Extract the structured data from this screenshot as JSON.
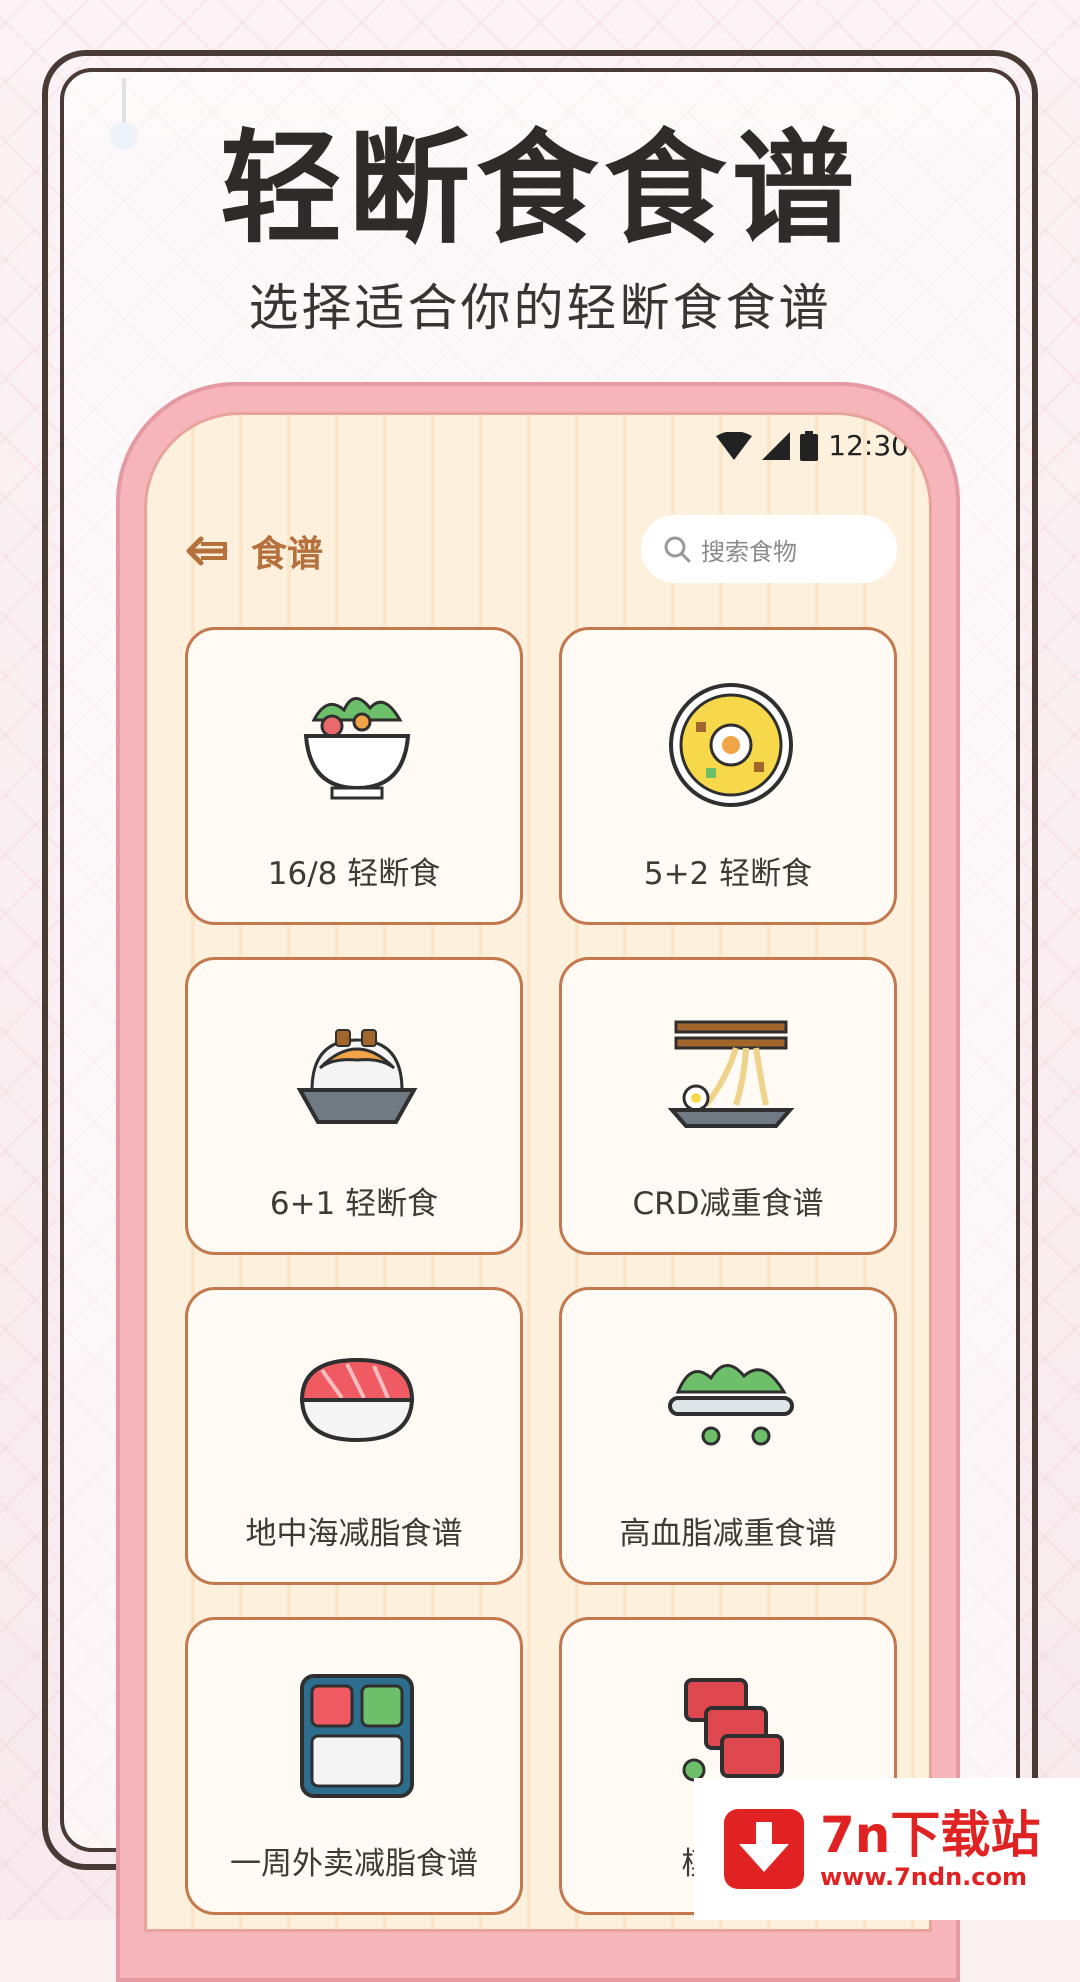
{
  "promo": {
    "headline": "轻断食食谱",
    "subtitle": "选择适合你的轻断食食谱"
  },
  "status_bar": {
    "time": "12:30",
    "icons": [
      "wifi-icon",
      "cellular-signal-icon",
      "battery-icon"
    ]
  },
  "app_bar": {
    "back_icon": "back-arrow-icon",
    "title": "食谱",
    "search_placeholder": "搜索食物"
  },
  "recipes": [
    {
      "label": "16/8 轻断食",
      "icon": "salad-bowl-icon"
    },
    {
      "label": "5+2 轻断食",
      "icon": "fried-egg-rice-plate-icon"
    },
    {
      "label": "6+1 轻断食",
      "icon": "rice-bowl-icon"
    },
    {
      "label": "CRD减重食谱",
      "icon": "noodles-chopsticks-icon"
    },
    {
      "label": "地中海减脂食谱",
      "icon": "sushi-icon"
    },
    {
      "label": "高血脂减重食谱",
      "icon": "vegetable-plate-icon"
    },
    {
      "label": "一周外卖减脂食谱",
      "icon": "bento-box-icon"
    },
    {
      "label": "模块化",
      "icon": "meat-stack-icon"
    }
  ],
  "watermark": {
    "title": "7n下载站",
    "url": "www.7ndn.com",
    "icon": "download-arrow-icon"
  },
  "colors": {
    "accent": "#b5703c",
    "card_border": "#c4784e",
    "phone_frame": "#f5b5bb",
    "watermark_red": "#e02222"
  }
}
